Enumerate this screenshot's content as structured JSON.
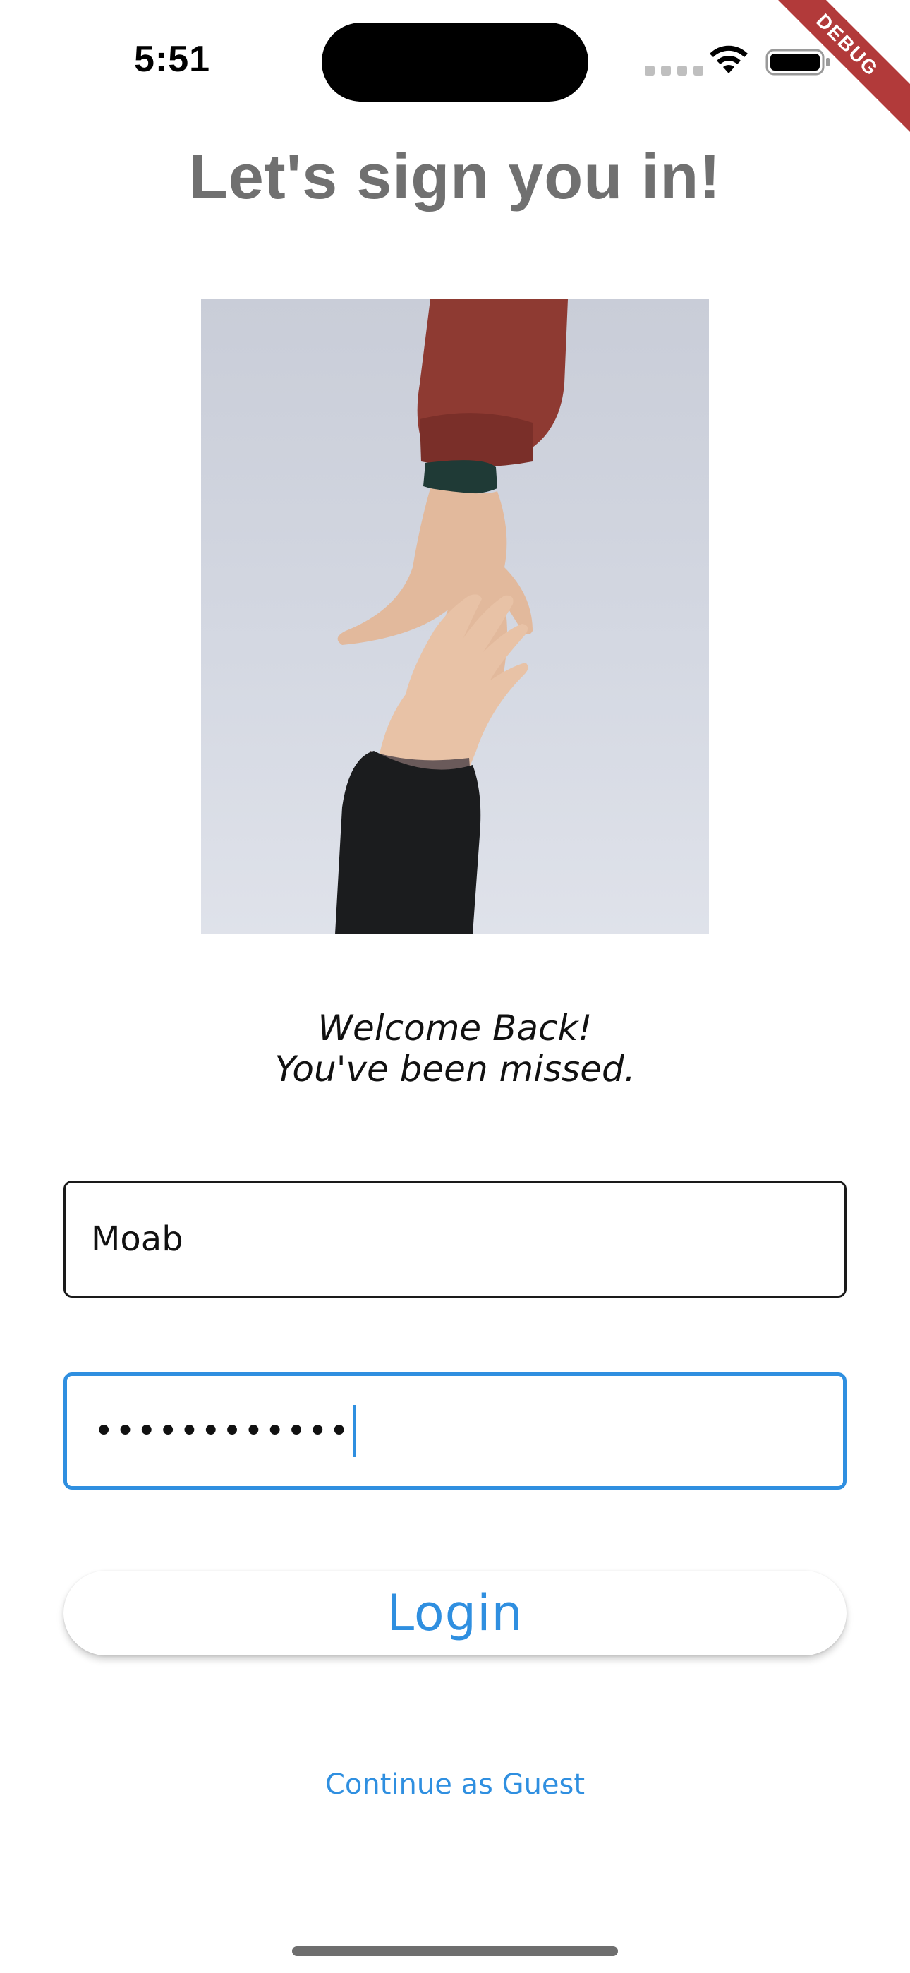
{
  "status_bar": {
    "time": "5:51"
  },
  "debug_banner": {
    "label": "DEBUG"
  },
  "header": {
    "title": "Let's sign you in!"
  },
  "hero": {
    "image": "two-hands-reaching"
  },
  "welcome": {
    "line1": "Welcome Back!",
    "line2": "You've been missed."
  },
  "form": {
    "username_value": "Moab",
    "password_value": "••••••••••••"
  },
  "actions": {
    "login_label": "Login",
    "guest_label": "Continue as Guest"
  },
  "colors": {
    "accent": "#2f8fe0",
    "title": "#707070",
    "debug": "#b23a3a"
  }
}
